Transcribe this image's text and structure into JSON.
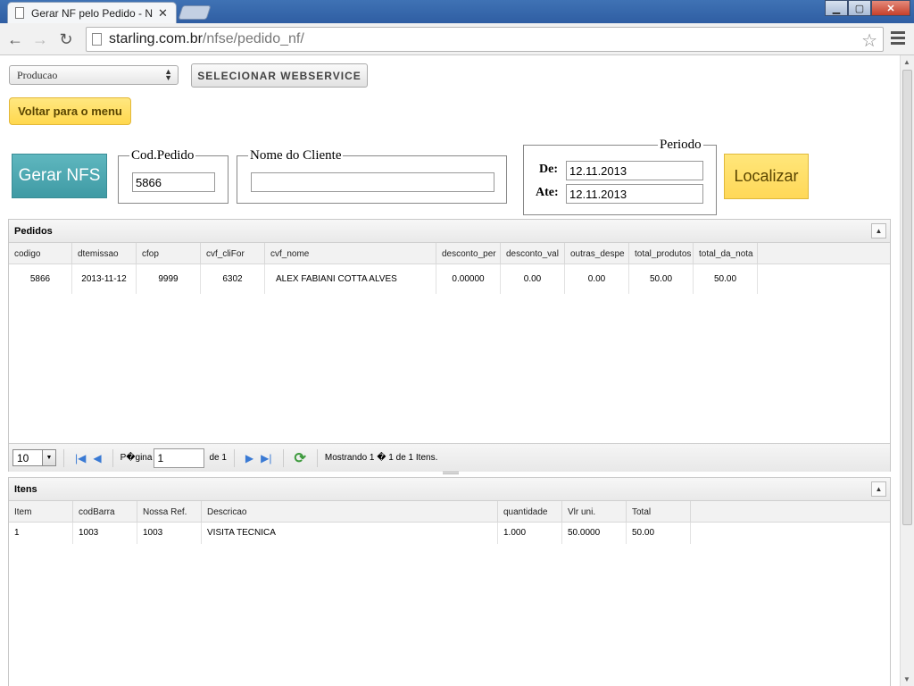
{
  "browser": {
    "tab_title": "Gerar NF pelo Pedido - Nc",
    "url_host": "starling.com.br",
    "url_path": "/nfse/pedido_nf/"
  },
  "env": {
    "selected": "Producao"
  },
  "buttons": {
    "select_ws": "SELECIONAR WEBSERVICE",
    "back_menu": "Voltar para o menu",
    "gerar_nfs": "Gerar NFS",
    "localizar": "Localizar"
  },
  "filters": {
    "cod_pedido_label": "Cod.Pedido",
    "cod_pedido_value": "5866",
    "nome_cliente_label": "Nome do Cliente",
    "nome_cliente_value": "",
    "periodo_label": "Periodo",
    "de_label": "De:",
    "de_value": "12.11.2013",
    "ate_label": "Ate:",
    "ate_value": "12.11.2013"
  },
  "pedidos": {
    "title": "Pedidos",
    "columns": [
      "codigo",
      "dtemissao",
      "cfop",
      "cvf_cliFor",
      "cvf_nome",
      "desconto_per",
      "desconto_val",
      "outras_despe",
      "total_produtos",
      "total_da_nota"
    ],
    "rows": [
      [
        "5866",
        "2013-11-12",
        "9999",
        "6302",
        "ALEX FABIANI COTTA ALVES",
        "0.00000",
        "0.00",
        "0.00",
        "50.00",
        "50.00"
      ]
    ]
  },
  "pager": {
    "page_size": "10",
    "page_label": "P�gina",
    "page_value": "1",
    "of_label": "de 1",
    "status": "Mostrando 1 � 1 de 1 Itens."
  },
  "itens": {
    "title": "Itens",
    "columns": [
      "Item",
      "codBarra",
      "Nossa Ref.",
      "Descricao",
      "quantidade",
      "Vlr uni.",
      "Total"
    ],
    "rows": [
      [
        "1",
        "1003",
        "1003",
        "VISITA TECNICA",
        "1.000",
        "50.0000",
        "50.00"
      ]
    ]
  }
}
